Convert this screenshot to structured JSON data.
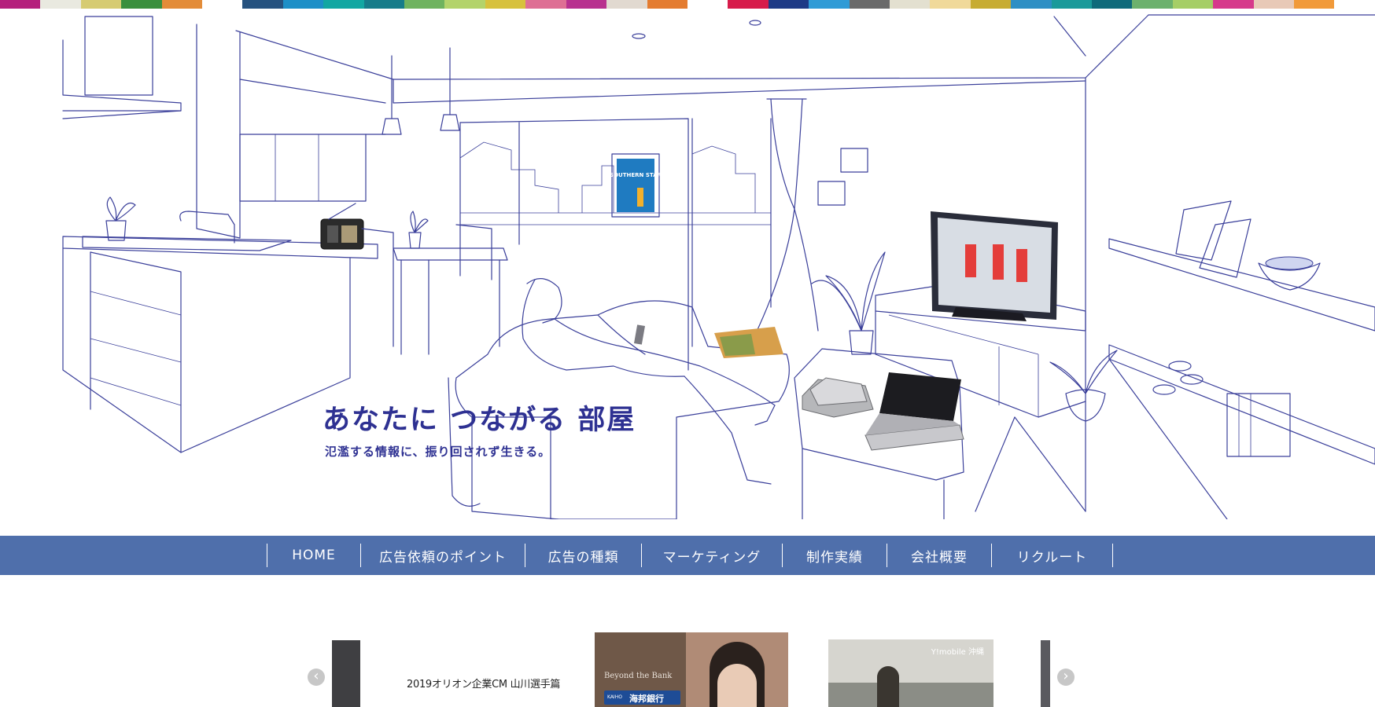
{
  "colors": {
    "accent_blue": "#2e3192",
    "nav_bg": "#4f6fab",
    "line_art": "#3a3f9a"
  },
  "color_strip": [
    "#b5217d",
    "#e9e9e0",
    "#d6cb72",
    "#3a8f3e",
    "#e38c39",
    "#ffffff",
    "#26527f",
    "#1d8fc7",
    "#12a7a2",
    "#167c8a",
    "#6fb35f",
    "#b3d36b",
    "#d7c13d",
    "#de6f94",
    "#b8318f",
    "#e1d9d0",
    "#e47c30",
    "#ffffff",
    "#d71c4b",
    "#1e3a86",
    "#2f9bd6",
    "#6a6a6a",
    "#e3e0d0",
    "#f0d99a",
    "#c7ac32",
    "#2e8fc4",
    "#1a9a9a",
    "#0f6a7a",
    "#6cb16d",
    "#a5ce66",
    "#d63a8b",
    "#e8c9b7",
    "#f19a3a",
    "#ffffff"
  ],
  "hero": {
    "title": "あなたに つながる 部屋",
    "subtitle": "氾濫する情報に、振り回されず生きる。",
    "poster_text": "SOUTHERN STAR"
  },
  "nav": {
    "items": [
      {
        "label": "HOME"
      },
      {
        "label": "広告依頼のポイント"
      },
      {
        "label": "広告の種類"
      },
      {
        "label": "マーケティング"
      },
      {
        "label": "制作実績"
      },
      {
        "label": "会社概要"
      },
      {
        "label": "リクルート"
      }
    ]
  },
  "carousel": {
    "prev_icon": "‹",
    "next_icon": "›",
    "slides": [
      {
        "caption": "2019オリオン企業CM 山川選手篇"
      },
      {
        "caption": "Beyond the Bank",
        "badge": "海邦銀行",
        "badge_small": "KAIHO"
      },
      {
        "caption": "Y!mobile 沖縄"
      }
    ]
  }
}
